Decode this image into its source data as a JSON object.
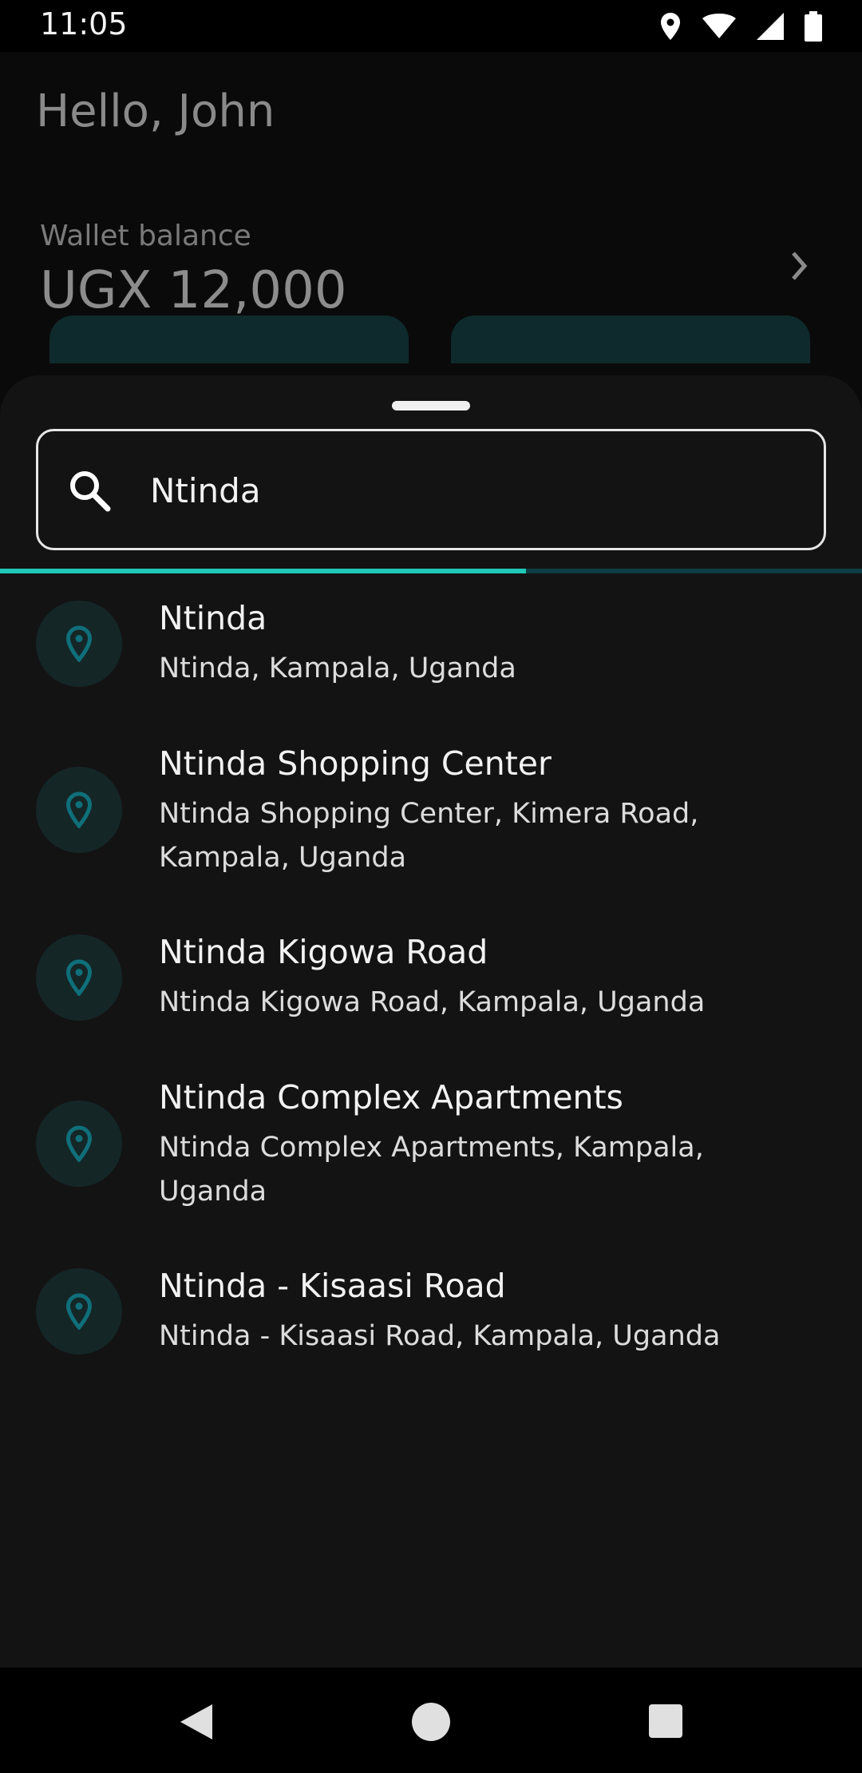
{
  "status": {
    "time": "11:05"
  },
  "background": {
    "greeting": "Hello, John",
    "wallet_label": "Wallet balance",
    "wallet_amount": "UGX 12,000"
  },
  "search": {
    "value": "Ntinda",
    "progress": 0.61
  },
  "results": [
    {
      "title": "Ntinda",
      "subtitle": "Ntinda, Kampala, Uganda"
    },
    {
      "title": "Ntinda Shopping Center",
      "subtitle": "Ntinda Shopping Center, Kimera Road, Kampala, Uganda"
    },
    {
      "title": "Ntinda Kigowa Road",
      "subtitle": "Ntinda Kigowa Road, Kampala, Uganda"
    },
    {
      "title": "Ntinda Complex Apartments",
      "subtitle": "Ntinda Complex Apartments, Kampala, Uganda"
    },
    {
      "title": "Ntinda - Kisaasi Road",
      "subtitle": "Ntinda - Kisaasi Road, Kampala, Uganda"
    }
  ],
  "colors": {
    "accent": "#1fc7b6",
    "pin": "#0f6f7a",
    "sheet": "#131313"
  }
}
